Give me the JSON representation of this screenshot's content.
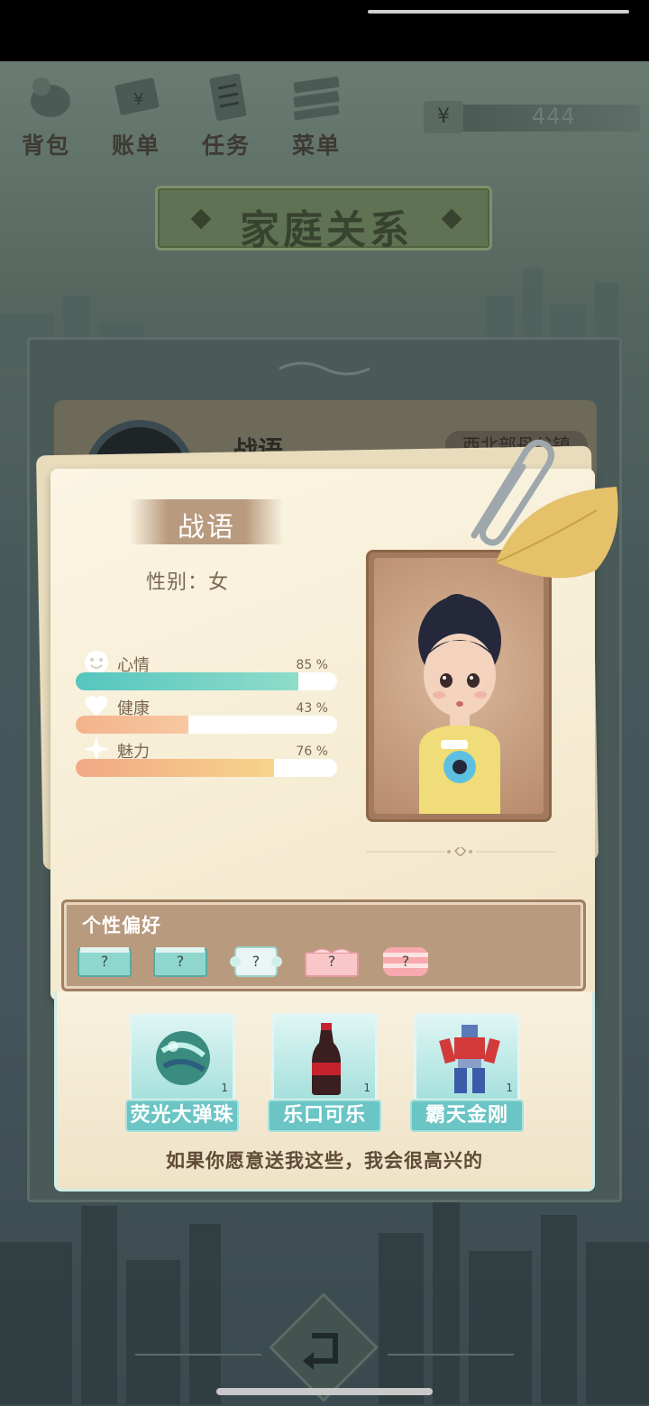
{
  "toolbar": {
    "items": [
      {
        "label": "背包",
        "icon": "backpack-icon"
      },
      {
        "label": "账单",
        "icon": "bill-icon"
      },
      {
        "label": "任务",
        "icon": "task-icon"
      },
      {
        "label": "菜单",
        "icon": "menu-icon"
      }
    ],
    "money_symbol": "¥",
    "money_amount": "444"
  },
  "page_title": "家庭关系",
  "behind_card": {
    "name": "战语",
    "location": "西北部丹谷镇"
  },
  "profile": {
    "name": "战语",
    "gender": "性别：女",
    "stats": [
      {
        "label": "心情",
        "percent": "85 %",
        "value": 85,
        "color_start": "#55c6bf",
        "color_end": "#8fdcc9",
        "icon": "smile-icon"
      },
      {
        "label": "健康",
        "percent": "43 %",
        "value": 43,
        "color_start": "#f3b38a",
        "color_end": "#f7c8a2",
        "icon": "heart-icon"
      },
      {
        "label": "魅力",
        "percent": "76 %",
        "value": 76,
        "color_start": "#f1a886",
        "color_end": "#f7d48a",
        "icon": "sparkle-icon"
      }
    ]
  },
  "preferences": {
    "title": "个性偏好",
    "items": [
      "?",
      "?",
      "?",
      "?",
      "?"
    ]
  },
  "gifts": {
    "items": [
      {
        "name": "荧光大弹珠",
        "count": "1",
        "icon": "marble-icon"
      },
      {
        "name": "乐口可乐",
        "count": "1",
        "icon": "cola-icon"
      },
      {
        "name": "霸天金刚",
        "count": "1",
        "icon": "robot-toy-icon"
      }
    ],
    "message": "如果你愿意送我这些，我会很高兴的"
  }
}
